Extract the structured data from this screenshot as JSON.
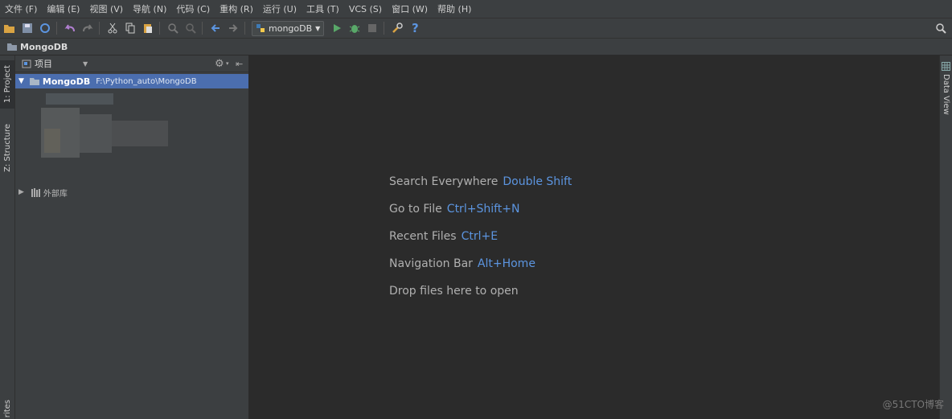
{
  "menu": [
    "文件 (F)",
    "编辑 (E)",
    "视图 (V)",
    "导航 (N)",
    "代码 (C)",
    "重构 (R)",
    "运行 (U)",
    "工具 (T)",
    "VCS (S)",
    "窗口 (W)",
    "帮助 (H)"
  ],
  "toolbar": {
    "run_config": "mongoDB"
  },
  "navbar": {
    "breadcrumb": "MongoDB"
  },
  "left_tabs": {
    "project": "1: Project",
    "structure": "Z: Structure",
    "favorites": "rites"
  },
  "right_tabs": {
    "data_view": "Data View"
  },
  "project_panel": {
    "view_selector": "项目",
    "root": {
      "name": "MongoDB",
      "path": "F:\\Python_auto\\MongoDB"
    },
    "external_libraries": "外部库"
  },
  "editor_hints": [
    {
      "label": "Search Everywhere",
      "key": "Double Shift"
    },
    {
      "label": "Go to File",
      "key": "Ctrl+Shift+N"
    },
    {
      "label": "Recent Files",
      "key": "Ctrl+E"
    },
    {
      "label": "Navigation Bar",
      "key": "Alt+Home"
    },
    {
      "label": "Drop files here to open",
      "key": ""
    }
  ],
  "watermark": "@51CTO博客",
  "colors": {
    "background": "#2b2b2b",
    "panel": "#3c3f41",
    "selection": "#4b6eaf",
    "shortcut": "#5c95e0"
  }
}
